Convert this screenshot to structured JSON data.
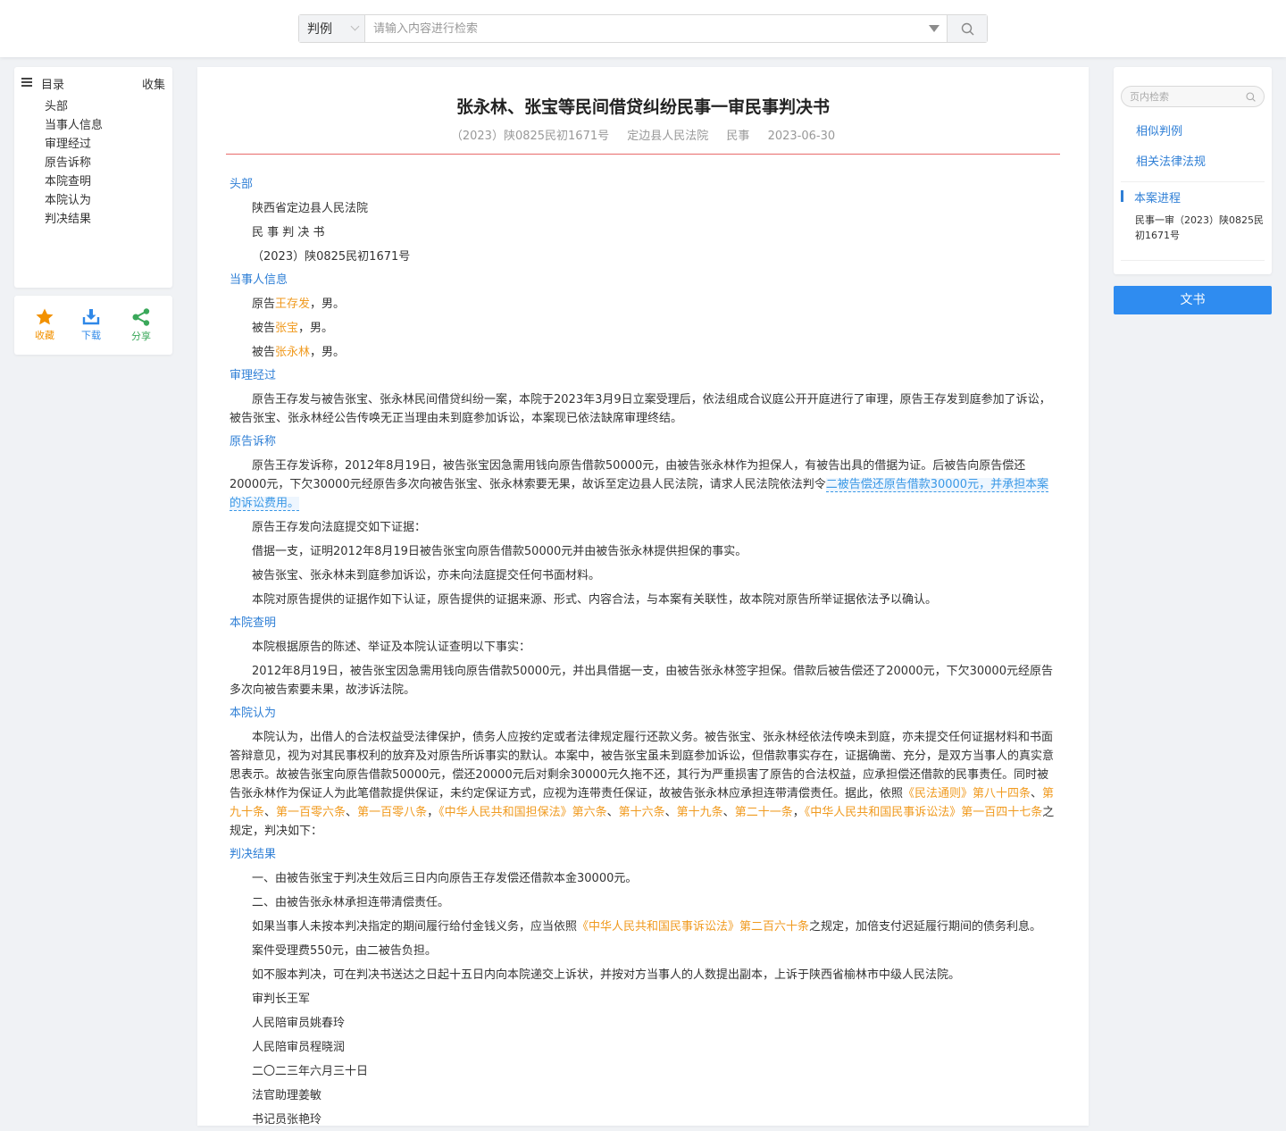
{
  "search": {
    "type_label": "判例",
    "placeholder": "请输入内容进行检索"
  },
  "toc": {
    "title": "目录",
    "collect_label": "收集",
    "items": [
      "头部",
      "当事人信息",
      "审理经过",
      "原告诉称",
      "本院查明",
      "本院认为",
      "判决结果"
    ]
  },
  "actions": {
    "favorite": "收藏",
    "download": "下载",
    "share": "分享"
  },
  "document": {
    "title": "张永林、张宝等民间借贷纠纷民事一审民事判决书",
    "case_no": "（2023）陕0825民初1671号",
    "court": "定边县人民法院",
    "case_type": "民事",
    "date": "2023-06-30",
    "sections": {
      "header": {
        "title": "头部",
        "lines": [
          "陕西省定边县人民法院",
          "民 事 判 决 书",
          "（2023）陕0825民初1671号"
        ]
      },
      "parties": {
        "title": "当事人信息",
        "plaintiff_prefix": "原告",
        "plaintiff": "王存发",
        "plaintiff_suffix": "，男。",
        "defendant1_prefix": "被告",
        "defendant1": "张宝",
        "defendant1_suffix": "，男。",
        "defendant2_prefix": "被告",
        "defendant2": "张永林",
        "defendant2_suffix": "，男。"
      },
      "trial": {
        "title": "审理经过",
        "text": "原告王存发与被告张宝、张永林民间借贷纠纷一案，本院于2023年3月9日立案受理后，依法组成合议庭公开开庭进行了审理，原告王存发到庭参加了诉讼，被告张宝、张永林经公告传唤无正当理由未到庭参加诉讼，本案现已依法缺席审理终结。"
      },
      "claims": {
        "title": "原告诉称",
        "text1": "原告王存发诉称，2012年8月19日，被告张宝因急需用钱向原告借款50000元，由被告张永林作为担保人，有被告出具的借据为证。后被告向原告偿还20000元，下欠30000元经原告多次向被告张宝、张永林索要无果，故诉至定边县人民法院，请求人民法院依法判令",
        "text1_highlight": "二被告偿还原告借款30000元，并承担本案的诉讼费用。",
        "lines": [
          "原告王存发向法庭提交如下证据：",
          "借据一支，证明2012年8月19日被告张宝向原告借款50000元并由被告张永林提供担保的事实。",
          "被告张宝、张永林未到庭参加诉讼，亦未向法庭提交任何书面材料。",
          "本院对原告提供的证据作如下认证，原告提供的证据来源、形式、内容合法，与本案有关联性，故本院对原告所举证据依法予以确认。"
        ]
      },
      "findings": {
        "title": "本院查明",
        "lines": [
          "本院根据原告的陈述、举证及本院认证查明以下事实：",
          "2012年8月19日，被告张宝因急需用钱向原告借款50000元，并出具借据一支，由被告张永林签字担保。借款后被告偿还了20000元，下欠30000元经原告多次向被告索要未果，故涉诉法院。"
        ]
      },
      "opinion": {
        "title": "本院认为",
        "text_a": "本院认为，出借人的合法权益受法律保护，债务人应按约定或者法律规定履行还款义务。被告张宝、张永林经依法传唤未到庭，亦未提交任何证据材料和书面答辩意见，视为对其民事权利的放弃及对原告所诉事实的默认。本案中，被告张宝虽未到庭参加诉讼，但借款事实存在，证据确凿、充分，是双方当事人的真实意思表示。故被告张宝向原告借款50000元，偿还20000元后对剩余30000元久拖不还，其行为严重损害了原告的合法权益，应承担偿还借款的民事责任。同时被告张永林作为保证人为此笔借款提供保证，未约定保证方式，应视为连带责任保证，故被告张永林应承担连带清偿责任。据此，依照",
        "law1": "《民法通则》第八十四条",
        "sep1": "、",
        "law2": "第九十条",
        "sep2": "、",
        "law3": "第一百零六条",
        "sep3": "、",
        "law4": "第一百零八条",
        "sep4": "，",
        "law5": "《中华人民共和国担保法》第六条",
        "sep5": "、",
        "law6": "第十六条",
        "sep6": "、",
        "law7": "第十九条",
        "sep7": "、",
        "law8": "第二十一条",
        "sep8": "，",
        "law9": "《中华人民共和国民事诉讼法》第一百四十七条",
        "text_b": "之规定，判决如下："
      },
      "judgment": {
        "title": "判决结果",
        "line1": "一、由被告张宝于判决生效后三日内向原告王存发偿还借款本金30000元。",
        "line2": "二、由被告张永林承担连带清偿责任。",
        "line3_a": "如果当事人未按本判决指定的期间履行给付金钱义务，应当依照",
        "line3_law": "《中华人民共和国民事诉讼法》第二百六十条",
        "line3_b": "之规定，加倍支付迟延履行期间的债务利息。",
        "lines": [
          "案件受理费550元，由二被告负担。",
          "如不服本判决，可在判决书送达之日起十五日内向本院递交上诉状，并按对方当事人的人数提出副本，上诉于陕西省榆林市中级人民法院。",
          "审判长王军",
          "人民陪审员姚春玲",
          "人民陪审员程晓润",
          "二〇二三年六月三十日",
          "法官助理姜敏",
          "书记员张艳玲"
        ]
      }
    }
  },
  "right_panel": {
    "search_placeholder": "页内检索",
    "similar_cases": "相似判例",
    "related_laws": "相关法律法规",
    "progress_title": "本案进程",
    "progress_item": "民事一审（2023）陕0825民初1671号"
  },
  "wenshu_button": "文书",
  "colors": {
    "accent_blue": "#2f8cf0",
    "section_blue": "#2f7fd6",
    "entity_orange": "#f09a1f",
    "divider_red": "#e86b6b"
  }
}
